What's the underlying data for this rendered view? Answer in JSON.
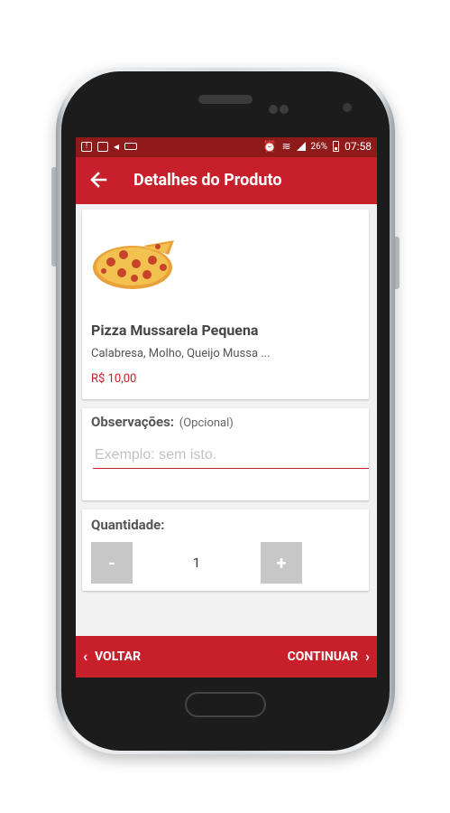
{
  "status_bar": {
    "battery_text": "26%",
    "time": "07:58"
  },
  "appbar": {
    "title": "Detalhes do Produto",
    "back_icon": "arrow-left-icon"
  },
  "product": {
    "name": "Pizza Mussarela Pequena",
    "description": "Calabresa, Molho, Queijo Mussa ...",
    "price": "R$ 10,00"
  },
  "observations": {
    "label": "Observações:",
    "optional": "(Opcional)",
    "placeholder": "Exemplo: sem isto.",
    "value": ""
  },
  "quantity": {
    "label": "Quantidade:",
    "decrement": "-",
    "value": "1",
    "increment": "+"
  },
  "bottom_nav": {
    "back_label": "VOLTAR",
    "next_label": "CONTINUAR"
  },
  "colors": {
    "primary": "#c8202a",
    "status_bar": "#8e1a1a",
    "stepper_button": "#c7c7c7"
  }
}
